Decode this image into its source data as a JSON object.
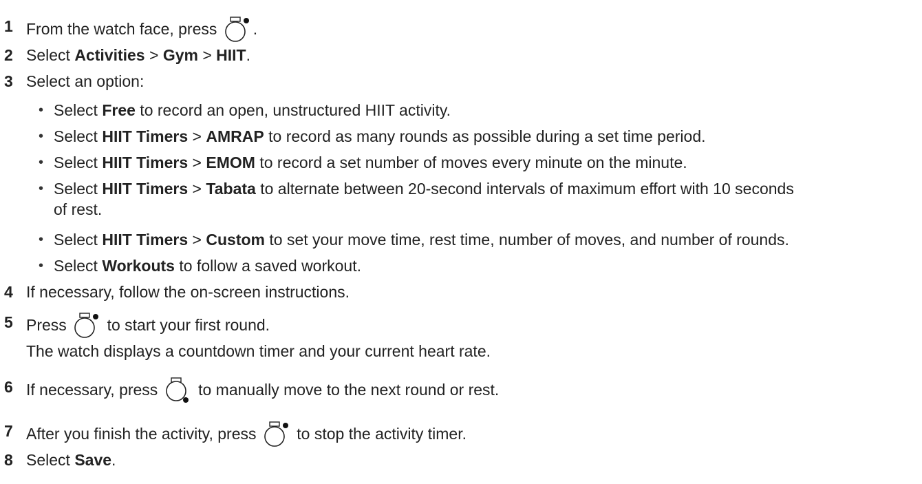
{
  "steps": [
    {
      "number": "1",
      "before": "From the watch face, press",
      "after": ".",
      "icon": "watch-start-stop-button-icon"
    },
    {
      "number": "2",
      "pre": "Select ",
      "b1": "Activities",
      "sep1": " > ",
      "b2": "Gym",
      "sep2": " > ",
      "b3": "HIIT",
      "post": "."
    },
    {
      "number": "3",
      "text": "Select an option:",
      "options": [
        {
          "pre": "Select ",
          "b1": "Free",
          "post": " to record an open, unstructured HIIT activity."
        },
        {
          "pre": "Select ",
          "b1": "HIIT Timers",
          "sep": " > ",
          "b2": "AMRAP",
          "post": " to record as many rounds as possible during a set time period."
        },
        {
          "pre": "Select ",
          "b1": "HIIT Timers",
          "sep": " > ",
          "b2": "EMOM",
          "post": " to record a set number of moves every minute on the minute."
        },
        {
          "pre": "Select ",
          "b1": "HIIT Timers",
          "sep": " > ",
          "b2": "Tabata",
          "post": " to alternate between 20-second intervals of maximum effort with 10 seconds",
          "post2": "of rest."
        },
        {
          "pre": "Select ",
          "b1": "HIIT Timers",
          "sep": " > ",
          "b2": "Custom",
          "post": " to set your move time, rest time, number of moves, and number of rounds."
        },
        {
          "pre": "Select ",
          "b1": "Workouts",
          "post": " to follow a saved workout."
        }
      ]
    },
    {
      "number": "4",
      "text": "If necessary, follow the on-screen instructions."
    },
    {
      "number": "5",
      "before": "Press",
      "after": "to start your first round.",
      "icon": "watch-start-stop-button-icon",
      "note": "The watch displays a countdown timer and your current heart rate."
    },
    {
      "number": "6",
      "before": "If necessary, press",
      "after": "to manually move to the next round or rest.",
      "icon": "watch-lap-button-icon"
    },
    {
      "number": "7",
      "before": "After you finish the activity, press",
      "after": "to stop the activity timer.",
      "icon": "watch-start-stop-button-icon"
    },
    {
      "number": "8",
      "pre": "Select ",
      "b1": "Save",
      "post": "."
    }
  ],
  "bullet_char": "•"
}
